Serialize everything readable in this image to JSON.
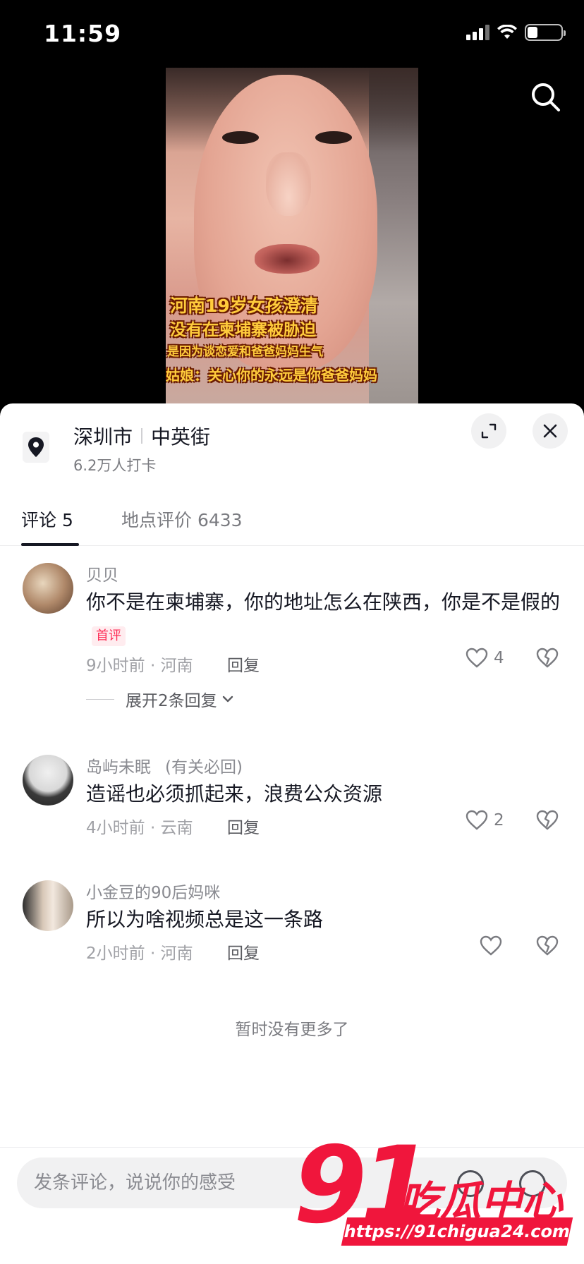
{
  "status_bar": {
    "time": "11:59"
  },
  "video": {
    "captions": [
      "河南19岁女孩澄清",
      "没有在柬埔寨被胁迫",
      "是因为谈恋爱和爸爸妈妈生气",
      "姑娘：关心你的永远是你爸爸妈妈"
    ]
  },
  "location": {
    "city": "深圳市",
    "street": "中英街",
    "checkins": "6.2万人打卡"
  },
  "tabs": [
    {
      "label": "评论 5",
      "active": true
    },
    {
      "label": "地点评价 6433",
      "active": false
    }
  ],
  "comments": [
    {
      "user": "贝贝",
      "tag": "",
      "text": "你不是在柬埔寨，你的地址怎么在陕西，你是不是假的",
      "badge": "首评",
      "time_loc": "9小时前 · 河南",
      "reply": "回复",
      "likes": "4",
      "expand": "展开2条回复"
    },
    {
      "user": "岛屿未眠",
      "tag": "(有关必回)",
      "text": "造谣也必须抓起来，浪费公众资源",
      "badge": "",
      "time_loc": "4小时前 · 云南",
      "reply": "回复",
      "likes": "2",
      "expand": ""
    },
    {
      "user": "小金豆的90后妈咪",
      "tag": "",
      "text": "所以为啥视频总是这一条路",
      "badge": "",
      "time_loc": "2小时前 · 河南",
      "reply": "回复",
      "likes": "",
      "expand": ""
    }
  ],
  "no_more": "暂时没有更多了",
  "input": {
    "placeholder": "发条评论，说说你的感受"
  },
  "watermark": {
    "logo_number": "91",
    "logo_text": "吃瓜中心",
    "url": "https://91chigua24.com"
  },
  "colors": {
    "accent_red": "#fe2c55",
    "watermark_red": "#f0163c",
    "text": "#161823",
    "muted": "#7a7b80"
  }
}
